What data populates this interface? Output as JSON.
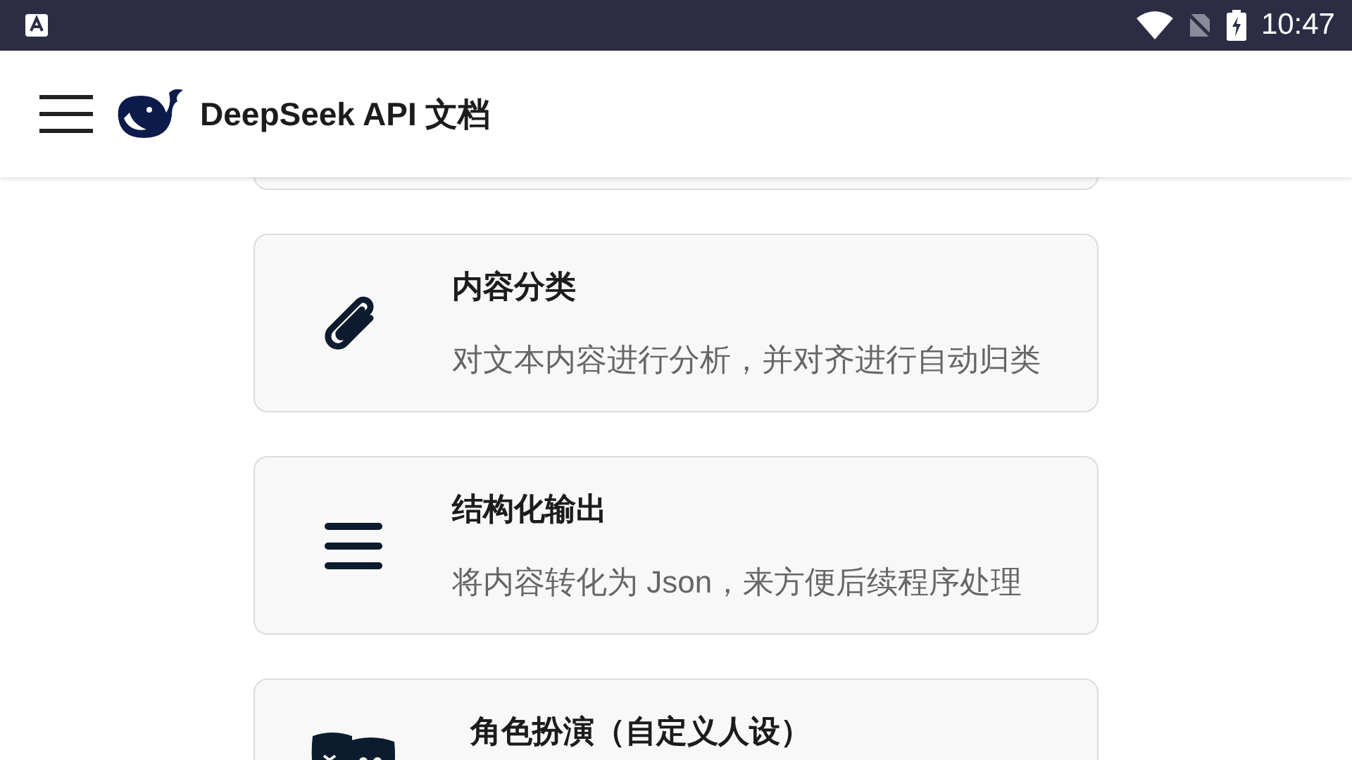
{
  "status_bar": {
    "time": "10:47"
  },
  "header": {
    "title": "DeepSeek API 文档"
  },
  "cards": [
    {
      "kind": "paperclip",
      "title": "内容分类",
      "description": "对文本内容进行分析，并对齐进行自动归类"
    },
    {
      "kind": "lines",
      "title": "结构化输出",
      "description": "将内容转化为 Json，来方便后续程序处理"
    },
    {
      "kind": "masks",
      "title": "角色扮演（自定义人设）"
    }
  ]
}
